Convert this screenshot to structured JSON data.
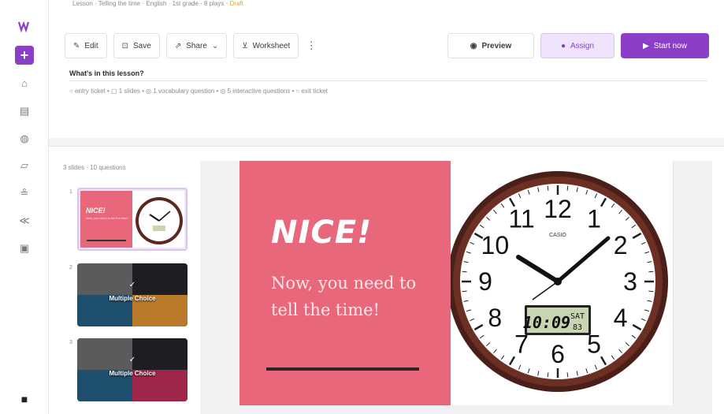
{
  "breadcrumbs": {
    "text": "Lesson · Telling the time · English · 1st grade · 8 plays · ",
    "status": "Draft"
  },
  "toolbar": {
    "edit": "Edit",
    "save": "Save",
    "share": "Share",
    "worksheet": "Worksheet",
    "preview": "Preview",
    "assign": "Assign",
    "start": "Start now"
  },
  "lesson": {
    "header": "What's in this lesson?",
    "summary": "○ entry ticket  •  ▢ 1 slides  •  ◎ 1 vocabulary question  •  ◎ 5 interactive questions  •  ○ exit ticket"
  },
  "panel": {
    "slide_count": "3 slides · 10 questions",
    "thumbs": [
      {
        "num": "1",
        "nice": "NICE!",
        "sub": "Now, you need to tell the time!"
      },
      {
        "num": "2",
        "label": "Multiple Choice"
      },
      {
        "num": "3",
        "label": "Multiple Choice"
      }
    ]
  },
  "slide": {
    "title": "NICE!",
    "subtitle": "Now, you need to tell the time!",
    "clock": {
      "numbers": [
        "12",
        "1",
        "2",
        "3",
        "4",
        "5",
        "6",
        "7",
        "8",
        "9",
        "10",
        "11"
      ],
      "brand": "CASIO",
      "digital_time": "10:09",
      "digital_day": "SAT",
      "digital_date": "83"
    }
  },
  "colors": {
    "accent": "#8b3fc9",
    "slide_bg": "#e8677b",
    "clock_frame": "#5a2820"
  },
  "icons": [
    "logo-icon",
    "plus-icon",
    "home-icon",
    "library-icon",
    "reports-icon",
    "classes-icon",
    "people-icon",
    "share-icon",
    "book-icon",
    "lock-icon"
  ]
}
